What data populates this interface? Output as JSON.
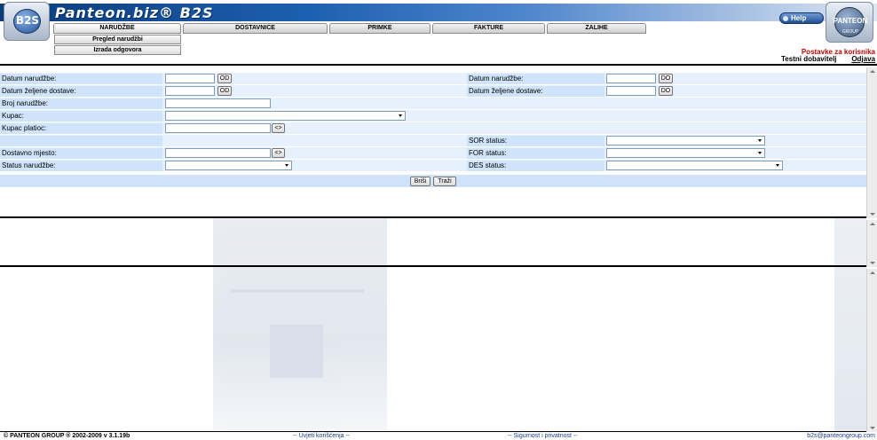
{
  "header": {
    "title": "Panteon.biz® B2S",
    "logo_left": "B2S",
    "logo_right": "PANTEON",
    "logo_right_sub": "GROUP",
    "help_label": "Help",
    "tabs": [
      {
        "label": "NARUDŽBE",
        "active": true
      },
      {
        "label": "DOSTAVNICE",
        "active": false
      },
      {
        "label": "PRIMKE",
        "active": false
      },
      {
        "label": "FAKTURE",
        "active": false
      },
      {
        "label": "ZALIHE",
        "active": false
      }
    ],
    "submenu": [
      "Pregled narudžbi",
      "Izrada odgovora"
    ],
    "settings_link": "Postavke za korisnika",
    "user_name": "Testni dobavitelj",
    "logout": "Odjava"
  },
  "form": {
    "left": {
      "datum_narudzbe": "Datum narudžbe:",
      "datum_dostave": "Datum željene dostave:",
      "broj_narudzbe": "Broj narudžbe:",
      "kupac": "Kupac:",
      "kupac_platioc": "Kupac platioc:",
      "dostavno_mjesto": "Dostavno mjesto:",
      "status_narudzbe": "Status narudžbe:"
    },
    "right": {
      "datum_narudzbe": "Datum narudžbe:",
      "datum_dostave": "Datum željene dostave:",
      "sor_status": "SOR status:",
      "for_status": "FOR status:",
      "des_status": "DES status:"
    },
    "btn_od": "OD",
    "btn_do": "DO",
    "btn_lookup": "<>",
    "values": {
      "datum_od": "",
      "datum_dostave_od": "",
      "datum_do": "",
      "datum_dostave_do": "",
      "broj_narudzbe": "",
      "kupac": "",
      "kupac_platioc": "",
      "dostavno_mjesto": "",
      "status_narudzbe": "",
      "sor_status": "",
      "for_status": "",
      "des_status": ""
    },
    "clear_button": "Briši",
    "search_button": "Traži"
  },
  "footer": {
    "copyright": "© PANTEON GROUP ® 2002-2009 v 3.1.19b",
    "terms": "-- Uvjeti korišćenja --",
    "privacy": "-- Sigurnost i privatnost --",
    "email": "b2s@panteongroup.com"
  }
}
